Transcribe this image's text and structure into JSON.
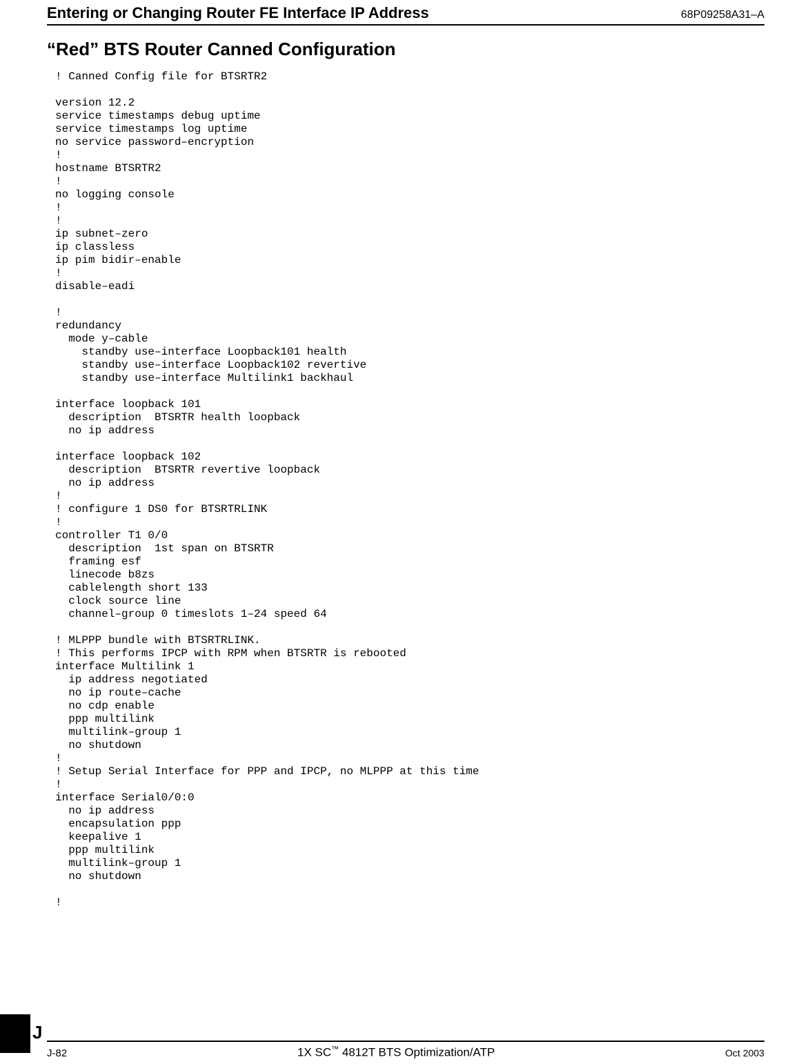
{
  "header": {
    "left": "Entering or Changing Router FE Interface IP Address",
    "right": "68P09258A31–A"
  },
  "section_title": "“Red” BTS Router Canned Configuration",
  "code": "! Canned Config file for BTSRTR2\n\nversion 12.2\nservice timestamps debug uptime\nservice timestamps log uptime\nno service password–encryption\n!\nhostname BTSRTR2\n!\nno logging console\n!\n!\nip subnet–zero\nip classless\nip pim bidir–enable\n!\ndisable–eadi\n\n!\nredundancy\n  mode y–cable\n    standby use–interface Loopback101 health\n    standby use–interface Loopback102 revertive\n    standby use–interface Multilink1 backhaul\n\ninterface loopback 101\n  description  BTSRTR health loopback\n  no ip address\n\ninterface loopback 102\n  description  BTSRTR revertive loopback\n  no ip address\n!\n! configure 1 DS0 for BTSRTRLINK\n!\ncontroller T1 0/0\n  description  1st span on BTSRTR\n  framing esf\n  linecode b8zs\n  cablelength short 133\n  clock source line\n  channel–group 0 timeslots 1–24 speed 64\n\n! MLPPP bundle with BTSRTRLINK.\n! This performs IPCP with RPM when BTSRTR is rebooted\ninterface Multilink 1\n  ip address negotiated\n  no ip route–cache\n  no cdp enable\n  ppp multilink\n  multilink–group 1\n  no shutdown\n!\n! Setup Serial Interface for PPP and IPCP, no MLPPP at this time\n!\ninterface Serial0/0:0\n  no ip address\n  encapsulation ppp\n  keepalive 1\n  ppp multilink\n  multilink–group 1\n  no shutdown\n\n!",
  "side_letter": "J",
  "footer": {
    "left": "J-82",
    "center_prefix": "1X SC",
    "center_tm": "™",
    "center_suffix": " 4812T BTS Optimization/ATP",
    "right": "Oct 2003"
  }
}
